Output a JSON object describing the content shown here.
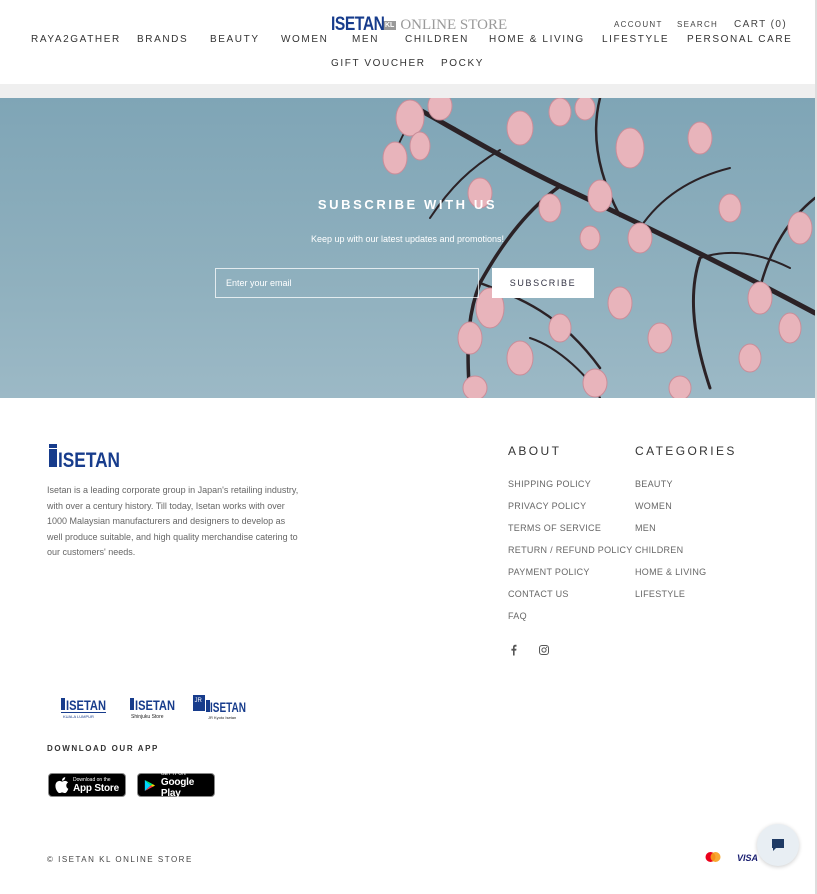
{
  "header": {
    "logo": {
      "brand": "ISETAN",
      "badge": "KL",
      "store": "ONLINE STORE"
    },
    "account_label": "ACCOUNT",
    "search_label": "SEARCH",
    "cart_label": "CART (0)",
    "nav": [
      "RAYA2GATHER",
      "BRANDS",
      "BEAUTY",
      "WOMEN",
      "MEN",
      "CHILDREN",
      "HOME & LIVING",
      "LIFESTYLE",
      "PERSONAL CARE",
      "GIFT VOUCHER",
      "POCKY"
    ]
  },
  "subscribe": {
    "title": "SUBSCRIBE WITH US",
    "subtitle": "Keep up with our latest updates and promotions!",
    "email_placeholder": "Enter your email",
    "button_label": "SUBSCRIBE"
  },
  "footer": {
    "logo_text": "ISETAN",
    "description": "Isetan is a leading corporate group in Japan's retailing industry, with over a century history. Till today, Isetan works with over 1000 Malaysian manufacturers and designers to develop as well produce suitable, and high quality merchandise catering to our customers' needs.",
    "about": {
      "heading": "ABOUT",
      "links": [
        "SHIPPING POLICY",
        "PRIVACY POLICY",
        "TERMS OF SERVICE",
        "RETURN / REFUND POLICY",
        "PAYMENT POLICY",
        "CONTACT US",
        "FAQ"
      ]
    },
    "categories": {
      "heading": "CATEGORIES",
      "links": [
        "BEAUTY",
        "WOMEN",
        "MEN",
        "CHILDREN",
        "HOME & LIVING",
        "LIFESTYLE"
      ]
    },
    "social_icons": [
      "facebook-icon",
      "instagram-icon"
    ],
    "store_logos": [
      {
        "name": "ISETAN",
        "sub": "KUALA LUMPUR"
      },
      {
        "name": "ISETAN",
        "sub": "Shinjuku Store"
      },
      {
        "name": "ISETAN",
        "sub": "JR Kyoto Isetan",
        "prefix": "JR"
      }
    ],
    "download_heading": "DOWNLOAD OUR APP",
    "app_store": {
      "small": "Download on the",
      "big": "App Store"
    },
    "google_play": {
      "small": "GET IT ON",
      "big": "Google Play"
    },
    "copyright": "© ISETAN KL ONLINE STORE",
    "payment": {
      "visa": "VISA"
    }
  },
  "colors": {
    "brand_blue": "#173c8c",
    "hero_sky": "#8fb0be"
  }
}
